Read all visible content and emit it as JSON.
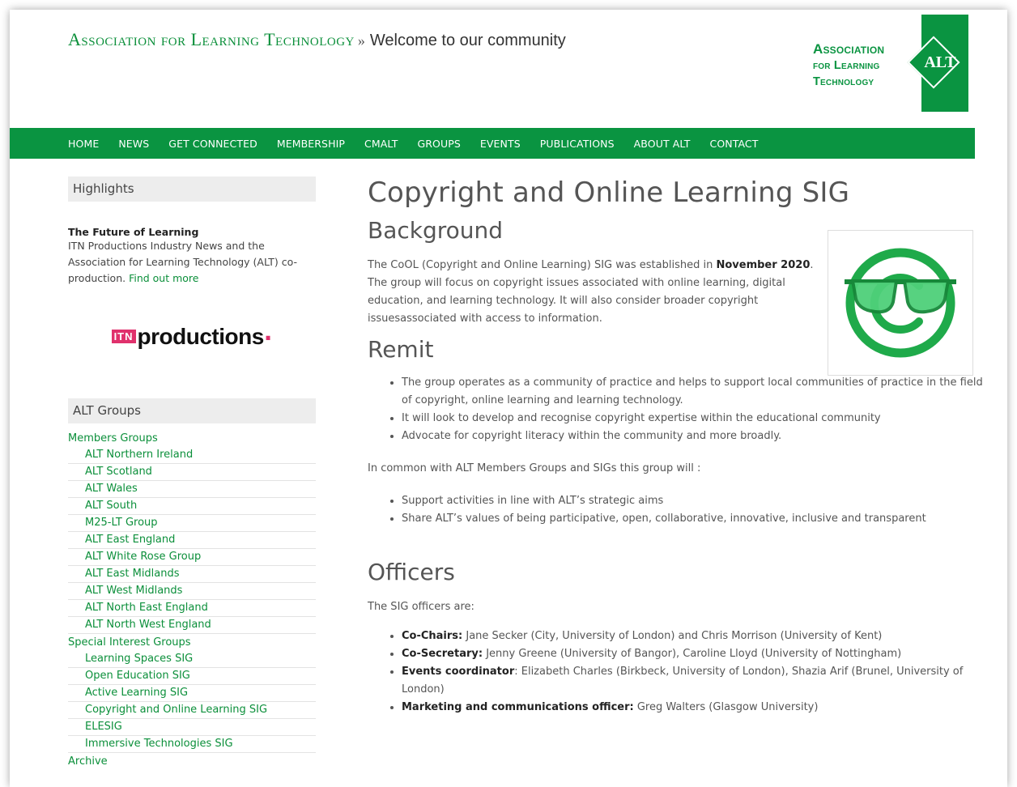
{
  "header": {
    "org_name": "Association for Learning Technology",
    "separator": "»",
    "tagline": "Welcome to our community",
    "logo": {
      "line1": "Association",
      "line2": "for Learning",
      "line3": "Technology",
      "mark": "ALT",
      "color": "#0a9441"
    }
  },
  "nav": [
    "HOME",
    "NEWS",
    "GET CONNECTED",
    "MEMBERSHIP",
    "CMALT",
    "GROUPS",
    "EVENTS",
    "PUBLICATIONS",
    "ABOUT ALT",
    "CONTACT"
  ],
  "sidebar": {
    "highlights": {
      "title": "Highlights",
      "item_title": "The Future of Learning",
      "item_body": "ITN Productions Industry News and the Association for Learning Technology (ALT) co-production.",
      "item_link": "Find out more",
      "logo_box": "ITN",
      "logo_word": "productions"
    },
    "groups": {
      "title": "ALT Groups",
      "members_label": "Members Groups",
      "members": [
        "ALT Northern Ireland",
        "ALT Scotland",
        "ALT Wales",
        "ALT South",
        "M25-LT Group",
        "ALT East England",
        "ALT White Rose Group",
        "ALT East Midlands",
        "ALT West Midlands",
        "ALT North East England",
        "ALT North West England"
      ],
      "sig_label": "Special Interest Groups",
      "sigs": [
        "Learning Spaces SIG",
        "Open Education SIG",
        "Active Learning SIG",
        "Copyright and Online Learning SIG",
        "ELESIG",
        "Immersive Technologies SIG"
      ],
      "archive_label": "Archive"
    }
  },
  "main": {
    "title": "Copyright and Online Learning SIG",
    "background": {
      "heading": "Background",
      "text_before": "The CoOL (Copyright and Online Learning) SIG was established in ",
      "text_bold": "November 2020",
      "text_after": ". The group will focus on copyright issues associated with online learning, digital education, and learning technology. It will also consider broader copyright issuesassociated with access to information."
    },
    "remit": {
      "heading": "Remit",
      "bullets": [
        "The group operates as a community of practice and helps to support local communities of practice in the field of copyright, online learning and learning technology.",
        "It will look to develop and recognise copyright expertise within the educational community",
        "Advocate for copyright literacy within the community and more broadly."
      ],
      "common_intro": "In common with ALT Members Groups and SIGs this group will :",
      "common_bullets": [
        "Support activities in line with ALT’s strategic aims",
        "Share ALT’s values of being participative, open, collaborative, innovative, inclusive and transparent"
      ]
    },
    "officers": {
      "heading": "Officers",
      "intro": "The SIG officers are:",
      "list": [
        {
          "role": "Co-Chairs:",
          "names": " Jane Secker (City, University of London) and Chris Morrison (University of Kent)"
        },
        {
          "role": "Co-Secretary:",
          "names": " Jenny Greene (University of Bangor), Caroline Lloyd (University of Nottingham)"
        },
        {
          "role": "Events coordinator",
          "names": ": Elizabeth Charles (Birkbeck, University of London), Shazia Arif (Brunel, University of London)"
        },
        {
          "role": "Marketing and communications officer:",
          "names": " Greg Walters (Glasgow University)"
        }
      ]
    }
  },
  "colors": {
    "brand_green": "#0a9441",
    "link_green": "#0b8f3a",
    "cool_logo_green": "#1faa4a",
    "itn_pink": "#e0316c"
  }
}
